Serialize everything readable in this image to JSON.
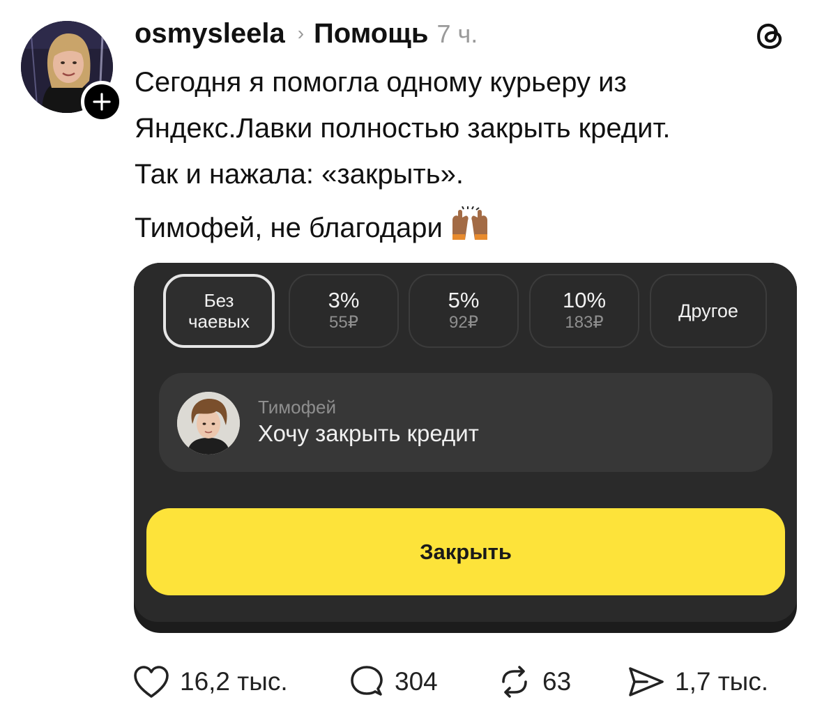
{
  "post": {
    "username": "osmysleela",
    "separator": "›",
    "community": "Помощь",
    "time": "7 ч.",
    "text_lines": [
      "Сегодня я помогла одному курьеру из",
      "Яндекс.Лавки полностью закрыть кредит.",
      "Так и нажала: «закрыть».",
      "Тимофей, не благодари"
    ],
    "emoji": "raising-hands-medium-dark-skin"
  },
  "attached_image": {
    "tips": [
      {
        "line1": "Без",
        "line2": "чаевых",
        "selected": true
      },
      {
        "percent": "3%",
        "amount": "55₽",
        "selected": false
      },
      {
        "percent": "5%",
        "amount": "92₽",
        "selected": false
      },
      {
        "percent": "10%",
        "amount": "183₽",
        "selected": false
      },
      {
        "label": "Другое",
        "selected": false
      }
    ],
    "courier": {
      "name": "Тимофей",
      "message": "Хочу закрыть кредит"
    },
    "button_label": "Закрыть",
    "colors": {
      "sheet": "#2a2a2a",
      "button": "#fde33a"
    }
  },
  "actions": {
    "likes": "16,2 тыс.",
    "comments": "304",
    "reposts": "63",
    "shares": "1,7 тыс."
  },
  "icons": [
    "plus-icon",
    "threads-logo-icon",
    "heart-icon",
    "comment-icon",
    "repost-icon",
    "send-icon"
  ]
}
